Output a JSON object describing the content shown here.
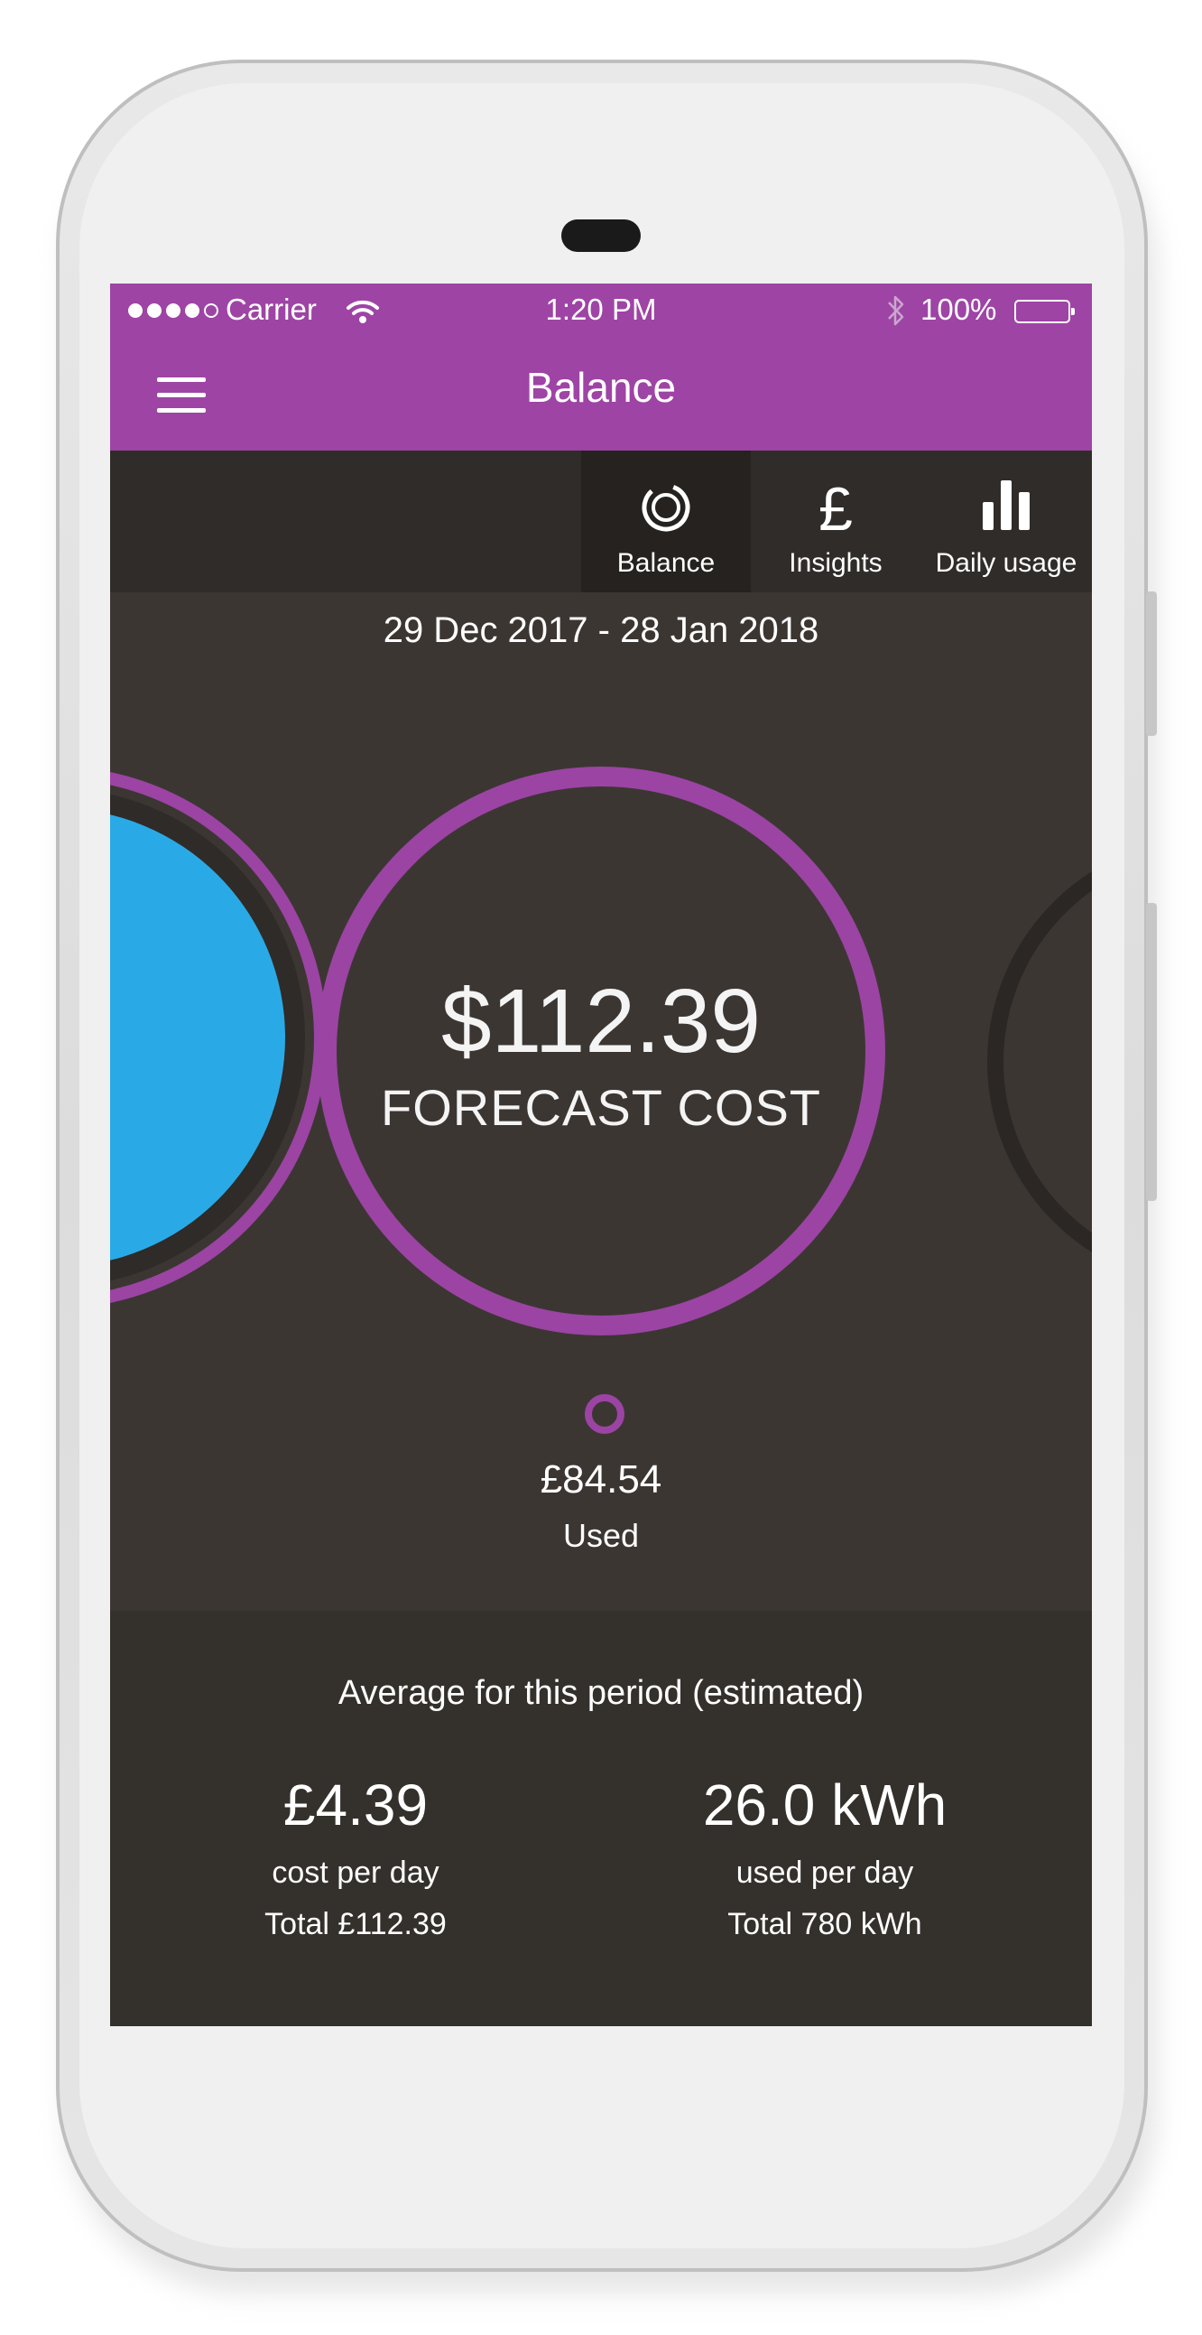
{
  "status_bar": {
    "carrier": "Carrier",
    "time": "1:20 PM",
    "battery": "100%",
    "signal_strength": 4,
    "signal_max": 5
  },
  "header": {
    "title": "Balance"
  },
  "tabs": [
    {
      "label": "Balance",
      "icon": "ring-progress-icon",
      "active": true
    },
    {
      "label": "Insights",
      "icon": "pound-icon",
      "active": false
    },
    {
      "label": "Daily usage",
      "icon": "bar-chart-icon",
      "active": false
    }
  ],
  "period": {
    "date_range": "29 Dec 2017 - 28 Jan 2018"
  },
  "forecast": {
    "value": "$112.39",
    "label": "FORECAST COST"
  },
  "used": {
    "value": "£84.54",
    "label": "Used"
  },
  "averages": {
    "title": "Average for this period (estimated)",
    "cost": {
      "value": "£4.39",
      "unit_label": "cost per day",
      "total": "Total £112.39"
    },
    "usage": {
      "value": "26.0 kWh",
      "unit_label": "used per day",
      "total": "Total 780 kWh"
    }
  },
  "colors": {
    "brand_purple": "#9e44a5",
    "ring_purple": "#9b44a3",
    "accent_blue": "#29aae7",
    "background": "#3c3633",
    "panel": "#34302c"
  }
}
